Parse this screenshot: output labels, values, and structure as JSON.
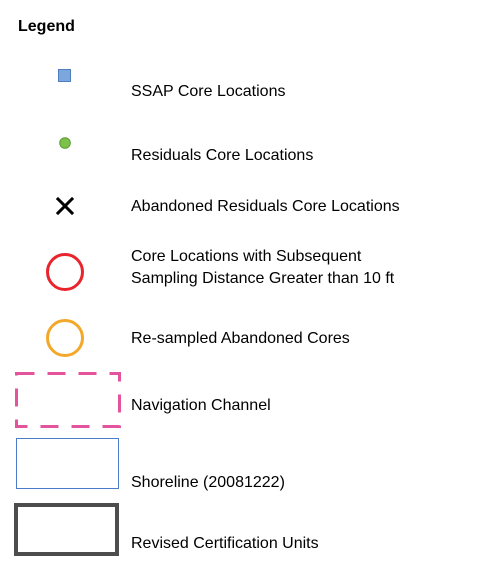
{
  "legend": {
    "title": "Legend",
    "items": [
      {
        "label": "SSAP Core Locations",
        "icon": "blue-square-icon",
        "fill": "#7ca7dc",
        "stroke": "#4f7fc0"
      },
      {
        "label": "Residuals Core Locations",
        "icon": "green-dot-icon",
        "fill": "#7cc24a",
        "stroke": "#5a9a32"
      },
      {
        "label": "Abandoned Residuals Core Locations",
        "icon": "black-x-icon",
        "stroke": "#000000"
      },
      {
        "label": "Core Locations with Subsequent\nSampling Distance Greater than 10 ft",
        "icon": "red-circle-icon",
        "stroke": "#e8242c"
      },
      {
        "label": "Re-sampled Abandoned Cores",
        "icon": "orange-circle-icon",
        "stroke": "#f4a82a"
      },
      {
        "label": "Navigation Channel",
        "icon": "pink-dashed-rectangle-icon",
        "stroke": "#e3549c"
      },
      {
        "label": "Shoreline (20081222)",
        "icon": "blue-outline-rectangle-icon",
        "stroke": "#4a7cc7"
      },
      {
        "label": "Revised Certification Units",
        "icon": "gray-outline-rectangle-icon",
        "stroke": "#4d4d4d"
      }
    ]
  }
}
